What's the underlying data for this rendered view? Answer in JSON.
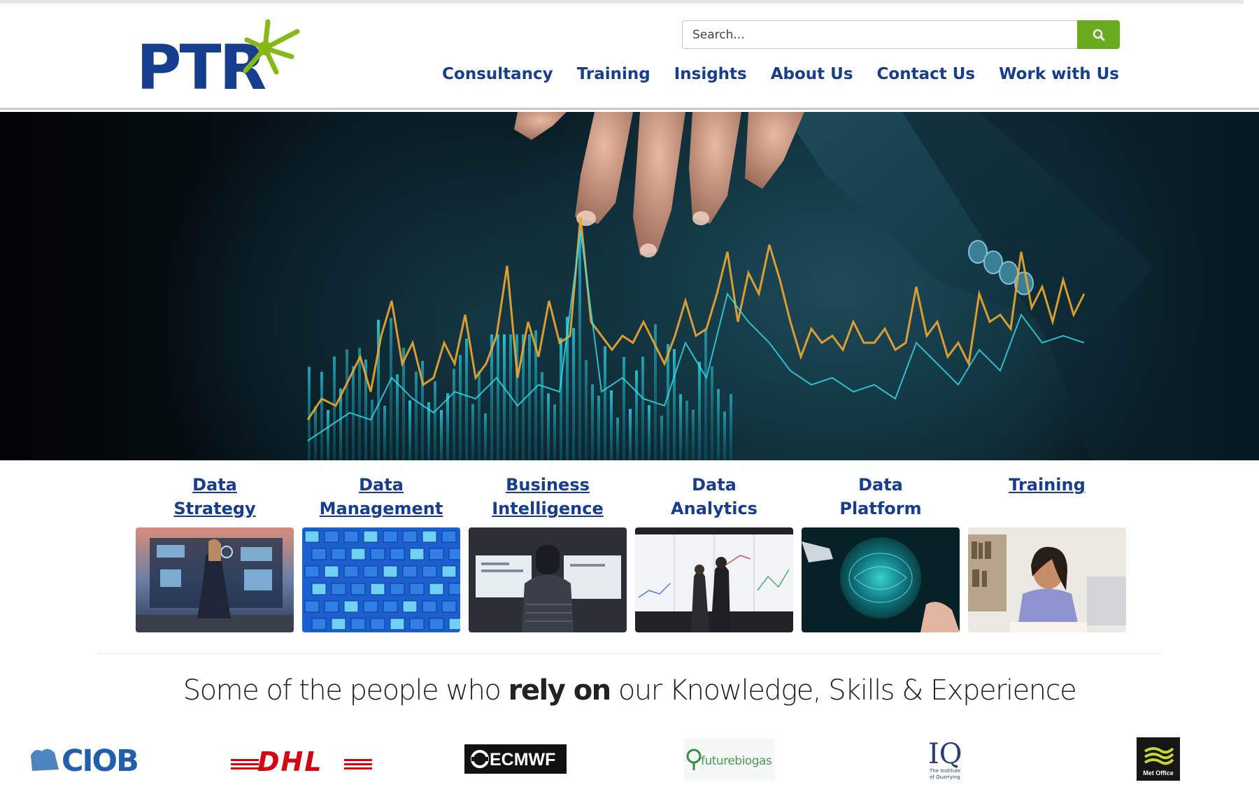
{
  "corner": {
    "number": "14"
  },
  "header": {
    "logo_text": "PTR",
    "search": {
      "placeholder": "Search..."
    },
    "nav": [
      {
        "label": "Consultancy"
      },
      {
        "label": "Training"
      },
      {
        "label": "Insights"
      },
      {
        "label": "About Us"
      },
      {
        "label": "Contact Us"
      },
      {
        "label": "Work with Us"
      }
    ]
  },
  "hero": {
    "slides": 3,
    "active_slide": 1
  },
  "services": [
    {
      "line1": "Data",
      "line2": "Strategy",
      "linked": true
    },
    {
      "line1": "Data",
      "line2": "Management",
      "linked": true
    },
    {
      "line1": "Business",
      "line2": "Intelligence",
      "linked": true
    },
    {
      "line1": "Data",
      "line2": "Analytics",
      "linked": false
    },
    {
      "line1": "Data",
      "line2": "Platform",
      "linked": false
    },
    {
      "line1": "",
      "line2": "Training",
      "linked": true
    }
  ],
  "tagline": {
    "before": "Some of the people who ",
    "bold": "rely on",
    "after": " our Knowledge, Skills & Experience"
  },
  "clients": [
    {
      "name": "CIOB"
    },
    {
      "name": "DHL"
    },
    {
      "name": "ECMWF"
    },
    {
      "name": "futurebiogas"
    },
    {
      "name": "IQ",
      "sub1": "The Institute",
      "sub2": "of Quarrying"
    },
    {
      "name": "Met Office"
    }
  ],
  "colors": {
    "brand_blue": "#173d8e",
    "brand_green": "#6aaa1f"
  }
}
